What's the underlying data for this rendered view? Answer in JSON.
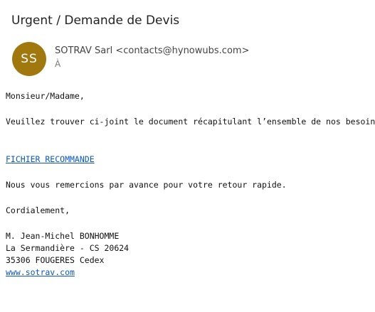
{
  "email": {
    "subject": "Urgent / Demande de Devis",
    "avatar_initials": "SS",
    "avatar_color": "#a0780e",
    "sender": "SOTRAV Sarl <contacts@hynowubs.com>",
    "recipient_label": "À",
    "greeting": "Monsieur/Madame,",
    "paragraph1": "Veuillez trouver ci-joint le document récapitulant l’ensemble de nos besoins.",
    "attachment_link": "FICHIER RECOMMANDE",
    "paragraph2": "Nous vous remercions par avance pour votre retour rapide.",
    "closing": "Cordialement,",
    "signature": {
      "name": "M. Jean-Michel BONHOMME",
      "address1": "La Sermandière - CS 20624",
      "address2": "35306 FOUGERES Cedex",
      "website": "www.sotrav.com"
    },
    "link_color": "#0b57c9"
  }
}
